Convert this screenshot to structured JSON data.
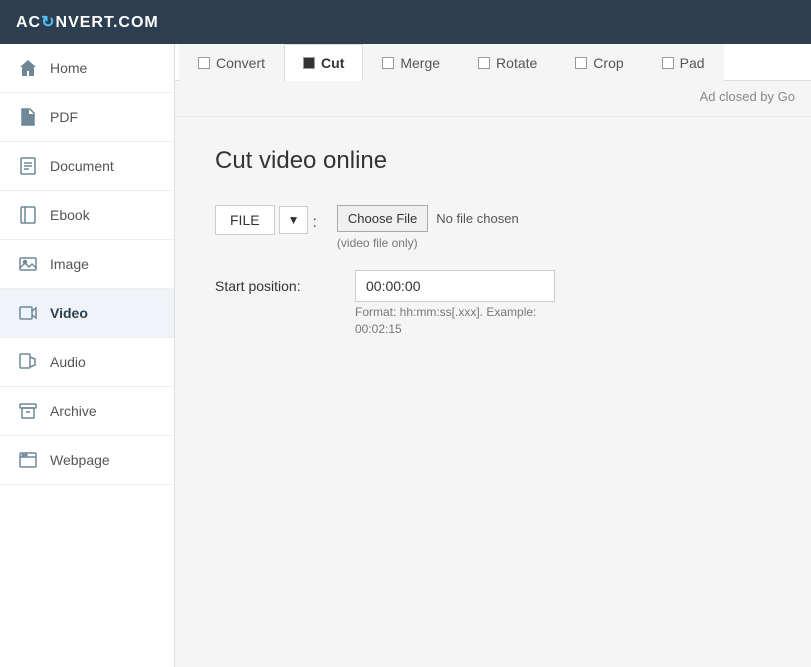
{
  "header": {
    "logo_text": "AC",
    "logo_spin": "↻",
    "logo_rest": "NVERT.COM"
  },
  "sidebar": {
    "items": [
      {
        "id": "home",
        "label": "Home",
        "icon": "home"
      },
      {
        "id": "pdf",
        "label": "PDF",
        "icon": "pdf"
      },
      {
        "id": "document",
        "label": "Document",
        "icon": "document"
      },
      {
        "id": "ebook",
        "label": "Ebook",
        "icon": "ebook"
      },
      {
        "id": "image",
        "label": "Image",
        "icon": "image"
      },
      {
        "id": "video",
        "label": "Video",
        "icon": "video",
        "active": true
      },
      {
        "id": "audio",
        "label": "Audio",
        "icon": "audio"
      },
      {
        "id": "archive",
        "label": "Archive",
        "icon": "archive"
      },
      {
        "id": "webpage",
        "label": "Webpage",
        "icon": "webpage"
      }
    ]
  },
  "tabs": [
    {
      "id": "convert",
      "label": "Convert",
      "checked": false
    },
    {
      "id": "cut",
      "label": "Cut",
      "checked": true,
      "active": true
    },
    {
      "id": "merge",
      "label": "Merge",
      "checked": false
    },
    {
      "id": "rotate",
      "label": "Rotate",
      "checked": false
    },
    {
      "id": "crop",
      "label": "Crop",
      "checked": false
    },
    {
      "id": "pad",
      "label": "Pad",
      "checked": false
    }
  ],
  "ad_bar": {
    "text": "Ad closed by Go"
  },
  "main": {
    "page_title": "Cut video online",
    "file_button_label": "FILE",
    "dropdown_arrow": "▼",
    "colon": ":",
    "choose_file_label": "Choose File",
    "no_file_text": "No file chosen",
    "file_hint": "(video file only)",
    "start_position_label": "Start position:",
    "start_position_value": "00:00:00",
    "format_hint": "Format: hh:mm:ss[.xxx]. Example:",
    "format_example": "00:02:15"
  }
}
